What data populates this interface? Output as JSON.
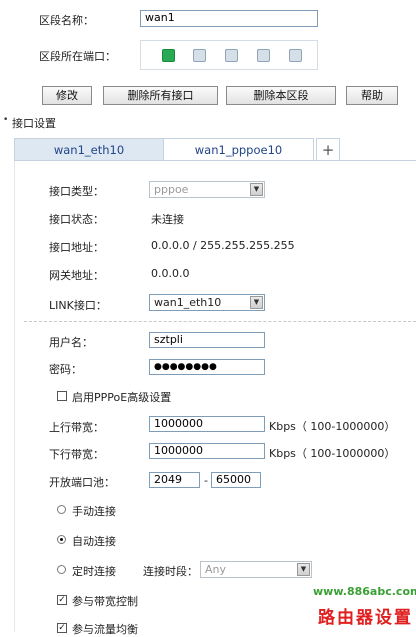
{
  "segment": {
    "name_label": "区段名称：",
    "name_value": "wan1",
    "ports_label": "区段所在端口：",
    "ports": [
      {
        "state": "active"
      },
      {
        "state": "inactive"
      },
      {
        "state": "inactive"
      },
      {
        "state": "inactive"
      },
      {
        "state": "inactive"
      }
    ]
  },
  "toolbar": {
    "modify": "修改",
    "delete_all": "删除所有接口",
    "delete_segment": "删除本区段",
    "help": "帮助"
  },
  "section_title": "接口设置",
  "tabs": [
    {
      "label": "wan1_eth10",
      "active": true
    },
    {
      "label": "wan1_pppoe10",
      "active": false
    },
    {
      "label": "+",
      "active": false
    }
  ],
  "form": {
    "type_label": "接口类型：",
    "type_value": "pppoe",
    "status_label": "接口状态：",
    "status_value": "未连接",
    "address_label": "接口地址：",
    "address_value": "0.0.0.0 / 255.255.255.255",
    "gateway_label": "网关地址：",
    "gateway_value": "0.0.0.0",
    "link_label": "LINK接口：",
    "link_value": "wan1_eth10",
    "username_label": "用户名：",
    "username_value": "sztpli",
    "password_label": "密码：",
    "password_value": "●●●●●●●●",
    "advanced_label": "启用PPPoE高级设置",
    "upload_label": "上行带宽：",
    "upload_value": "1000000",
    "upload_unit": "Kbps（ 100-1000000）",
    "download_label": "下行带宽：",
    "download_value": "1000000",
    "download_unit": "Kbps（ 100-1000000）",
    "port_pool_label": "开放端口池：",
    "port_pool_start": "2049",
    "port_pool_dash": "-",
    "port_pool_end": "65000",
    "manual_label": "手动连接",
    "auto_label": "自动连接",
    "timed_label": "定时连接",
    "period_label": "连接时段：",
    "period_value": "Any",
    "bandwidth_ctrl_label": "参与带宽控制",
    "load_balance_label": "参与流量均衡",
    "selected_mode": "auto"
  },
  "watermark": {
    "url": "www.886abc.com",
    "text": "路由器设置"
  },
  "colors": {
    "tab_active_bg": "#dde8f3",
    "panel_border": "#c5d3e0",
    "port_active": "#2aaa55",
    "watermark_url": "#3aa035",
    "watermark_text": "#e02020"
  }
}
